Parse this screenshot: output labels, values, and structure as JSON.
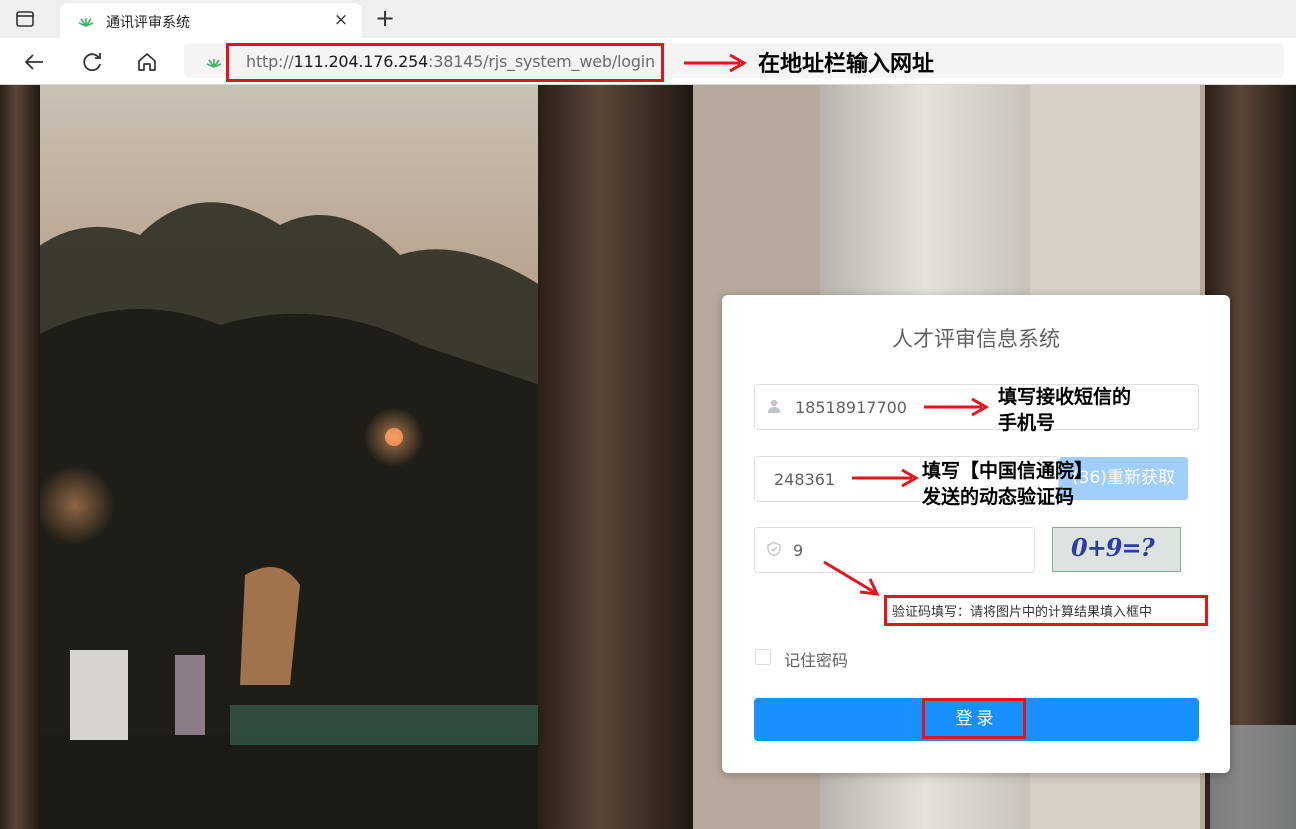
{
  "browser": {
    "tab_title": "通讯评审系统",
    "tab_close": "×",
    "new_tab": "+",
    "url_prefix": "http://",
    "url_host": "111.204.176.254",
    "url_rest": ":38145/rjs_system_web/login"
  },
  "annotations": {
    "address_hint": "在地址栏输入网址",
    "phone_hint_line1": "填写接收短信的",
    "phone_hint_line2": "手机号",
    "code_hint_line1": "填写【中国信通院】",
    "code_hint_line2": "发送的动态验证码",
    "captcha_hint": "验证码填写：请将图片中的计算结果填入框中"
  },
  "login": {
    "title": "人才评审信息系统",
    "phone_value": "18518917700",
    "sms_code_value": "248361",
    "sms_button": "(36)重新获取",
    "captcha_value": "9",
    "captcha_image_text": "0+9=?",
    "remember_label": "记住密码",
    "submit_label": "登录"
  },
  "colors": {
    "primary": "#1890ff",
    "sms_button_disabled": "#a0cfff",
    "annotation_red": "#e3151a"
  }
}
